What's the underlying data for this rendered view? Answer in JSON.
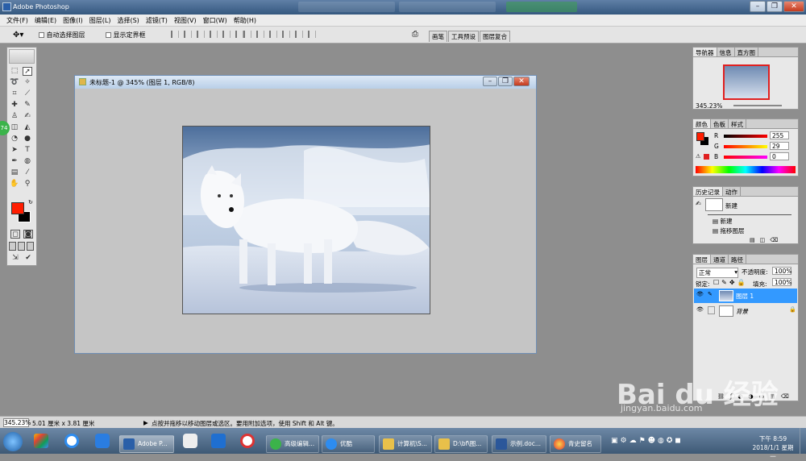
{
  "titlebar": {
    "title": "Adobe Photoshop"
  },
  "menu": [
    "文件(F)",
    "编辑(E)",
    "图像(I)",
    "图层(L)",
    "选择(S)",
    "滤镜(T)",
    "视图(V)",
    "窗口(W)",
    "帮助(H)"
  ],
  "options": {
    "auto_select": "自动选择图层",
    "show_bounds": "显示定界框"
  },
  "option_tabs": [
    "画笔",
    "工具预设",
    "图层复合"
  ],
  "document": {
    "title": "未标题-1 @ 345% (图层 1, RGB/8)"
  },
  "navigator": {
    "tabs": [
      "导航器",
      "信息",
      "直方图"
    ],
    "zoom": "345.23%"
  },
  "color": {
    "tabs": [
      "颜色",
      "色板",
      "样式"
    ],
    "r_label": "R",
    "g_label": "G",
    "b_label": "B",
    "r": "255",
    "g": "29",
    "b": "0",
    "foreground": "#ff1d00"
  },
  "history": {
    "tabs": [
      "历史记录",
      "动作"
    ],
    "snapshot": "新建",
    "items": [
      "新建",
      "拖移图层"
    ]
  },
  "layers": {
    "tabs": [
      "图层",
      "通道",
      "路径"
    ],
    "blend_mode": "正常",
    "opacity_label": "不透明度:",
    "opacity": "100%",
    "lock_label": "锁定:",
    "fill_label": "填充:",
    "fill": "100%",
    "rows": [
      {
        "name": "图层 1"
      },
      {
        "name": "背景"
      }
    ]
  },
  "status": {
    "zoom": "345.23%",
    "doc_size": "5.01 厘米 x 3.81 厘米",
    "hint": "点按并拖移以移动图层或选区。要用附加选项，使用 Shift 和 Alt 键。"
  },
  "taskbar": {
    "items": [
      "Adobe P...",
      "高级编辑...",
      "优酷",
      "计算机\\S...",
      "D:\\bf\\图...",
      "示例.doc...",
      "青史留名"
    ],
    "time": "下午 8:59",
    "date": "2018/1/1 星期一"
  },
  "watermark": {
    "brand": "Bai du 经验",
    "url": "jingyan.baidu.com"
  },
  "badge": "74"
}
